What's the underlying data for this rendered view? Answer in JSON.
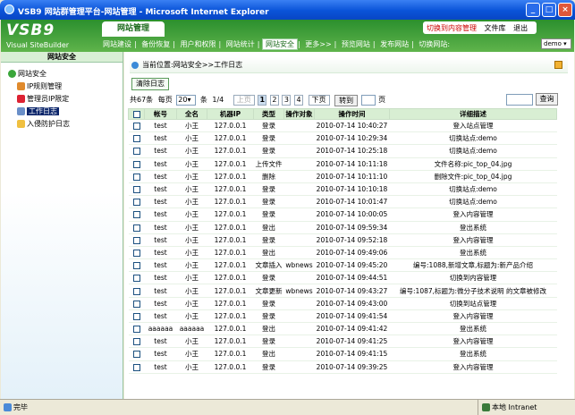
{
  "window": {
    "title": "VSB9 网站群管理平台-网站管理 - Microsoft Internet Explorer"
  },
  "app": {
    "logo": "VSB9",
    "logo_sub": "Visual SiteBuilder",
    "main_tab": "网站管理",
    "top_links": [
      "切换到内容管理",
      "文件库",
      "退出"
    ],
    "nav": [
      "网站建设",
      "备份恢复",
      "用户和权限",
      "网站统计",
      "网站安全",
      "更多>>",
      "预览网站",
      "发布网站",
      "切换网站:"
    ],
    "nav_selected": "网站安全",
    "site_select": "demo"
  },
  "sidebar": {
    "header": "网站安全",
    "root": "网站安全",
    "items": [
      "IP规则管理",
      "管理员IP限定",
      "工作日志",
      "入侵防护日志"
    ],
    "selected": "工作日志"
  },
  "breadcrumb": "当前位置:网站安全>>工作日志",
  "clear_button": "清除日志",
  "pager": {
    "total": "共67条",
    "per_page_label": "每页",
    "per_page": "20",
    "unit": "条",
    "page_info": "1/4",
    "prev": "上页",
    "pages": [
      "1",
      "2",
      "3",
      "4"
    ],
    "next": "下页",
    "goto": "转到",
    "page_unit": "页",
    "search": "查询"
  },
  "table": {
    "headers": [
      "帐号",
      "全名",
      "机器IP",
      "类型",
      "操作对象",
      "操作时间",
      "详细描述"
    ],
    "rows": [
      [
        "test",
        "小王",
        "127.0.0.1",
        "登录",
        "",
        "2010-07-14 10:40:27",
        "登入站点管理"
      ],
      [
        "test",
        "小王",
        "127.0.0.1",
        "登录",
        "",
        "2010-07-14 10:29:34",
        "切换站点:demo"
      ],
      [
        "test",
        "小王",
        "127.0.0.1",
        "登录",
        "",
        "2010-07-14 10:25:18",
        "切换站点:demo"
      ],
      [
        "test",
        "小王",
        "127.0.0.1",
        "上传文件",
        "",
        "2010-07-14 10:11:18",
        "文件名称:pic_top_04.jpg"
      ],
      [
        "test",
        "小王",
        "127.0.0.1",
        "删除",
        "",
        "2010-07-14 10:11:10",
        "删除文件:pic_top_04.jpg"
      ],
      [
        "test",
        "小王",
        "127.0.0.1",
        "登录",
        "",
        "2010-07-14 10:10:18",
        "切换站点:demo"
      ],
      [
        "test",
        "小王",
        "127.0.0.1",
        "登录",
        "",
        "2010-07-14 10:01:47",
        "切换站点:demo"
      ],
      [
        "test",
        "小王",
        "127.0.0.1",
        "登录",
        "",
        "2010-07-14 10:00:05",
        "登入内容管理"
      ],
      [
        "test",
        "小王",
        "127.0.0.1",
        "登出",
        "",
        "2010-07-14 09:59:34",
        "登出系统"
      ],
      [
        "test",
        "小王",
        "127.0.0.1",
        "登录",
        "",
        "2010-07-14 09:52:18",
        "登入内容管理"
      ],
      [
        "test",
        "小王",
        "127.0.0.1",
        "登出",
        "",
        "2010-07-14 09:49:06",
        "登出系统"
      ],
      [
        "test",
        "小王",
        "127.0.0.1",
        "文章插入",
        "wbnews",
        "2010-07-14 09:45:20",
        "编号:1088,新增文章,标题为:新产品介绍"
      ],
      [
        "test",
        "小王",
        "127.0.0.1",
        "登录",
        "",
        "2010-07-14 09:44:51",
        "切换到内容管理"
      ],
      [
        "test",
        "小王",
        "127.0.0.1",
        "文章更新",
        "wbnews",
        "2010-07-14 09:43:27",
        "编号:1087,标题为:微分子技术说明 的文章被修改"
      ],
      [
        "test",
        "小王",
        "127.0.0.1",
        "登录",
        "",
        "2010-07-14 09:43:00",
        "切换到站点管理"
      ],
      [
        "test",
        "小王",
        "127.0.0.1",
        "登录",
        "",
        "2010-07-14 09:41:54",
        "登入内容管理"
      ],
      [
        "aaaaaa",
        "aaaaaa",
        "127.0.0.1",
        "登出",
        "",
        "2010-07-14 09:41:42",
        "登出系统"
      ],
      [
        "test",
        "小王",
        "127.0.0.1",
        "登录",
        "",
        "2010-07-14 09:41:25",
        "登入内容管理"
      ],
      [
        "test",
        "小王",
        "127.0.0.1",
        "登出",
        "",
        "2010-07-14 09:41:15",
        "登出系统"
      ],
      [
        "test",
        "小王",
        "127.0.0.1",
        "登录",
        "",
        "2010-07-14 09:39:25",
        "登入内容管理"
      ]
    ]
  },
  "status": {
    "left": "完毕",
    "zone": "本地 Intranet"
  }
}
